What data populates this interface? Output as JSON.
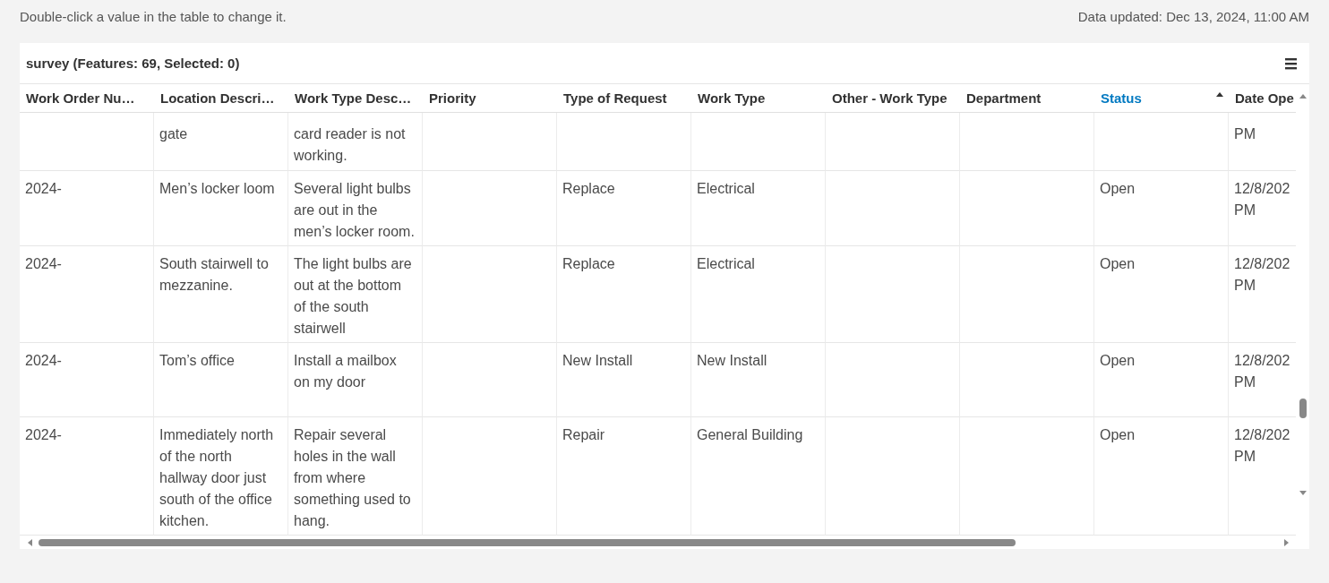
{
  "hint": "Double-click a value in the table to change it.",
  "updated": "Data updated: Dec 13, 2024, 11:00 AM",
  "table": {
    "title": "survey (Features: 69, Selected: 0)",
    "columns": [
      {
        "label": "Work Order Nu…",
        "sorted": false
      },
      {
        "label": "Location Descri…",
        "sorted": false
      },
      {
        "label": "Work Type Desc…",
        "sorted": false
      },
      {
        "label": "Priority",
        "sorted": false
      },
      {
        "label": "Type of Request",
        "sorted": false
      },
      {
        "label": "Work Type",
        "sorted": false
      },
      {
        "label": "Other - Work Type",
        "sorted": false
      },
      {
        "label": "Department",
        "sorted": false
      },
      {
        "label": "Status",
        "sorted": true
      },
      {
        "label": "Date Ope",
        "sorted": false
      }
    ],
    "rows": [
      {
        "kind": "partial",
        "cells": [
          "",
          "gate",
          "card reader is not working.",
          "",
          "",
          "",
          "",
          "",
          "",
          "PM"
        ]
      },
      {
        "kind": "full",
        "cells": [
          "2024-",
          "Men’s locker loom",
          "Several light bulbs are out in the men’s locker room.",
          "",
          "Replace",
          "Electrical",
          "",
          "",
          "Open",
          "12/8/202 PM"
        ]
      },
      {
        "kind": "full",
        "cells": [
          "2024-",
          "South stairwell to mezzanine.",
          "The light bulbs are out at the bottom of the south stairwell",
          "",
          "Replace",
          "Electrical",
          "",
          "",
          "Open",
          "12/8/202 PM"
        ]
      },
      {
        "kind": "full",
        "cells": [
          "2024-",
          "Tom’s office",
          "Install a mailbox on my door",
          "",
          "New Install",
          "New Install",
          "",
          "",
          "Open",
          "12/8/202 PM"
        ]
      },
      {
        "kind": "full",
        "cells": [
          "2024-",
          "Immediately north of the north hallway door just south of the office kitchen.",
          "Repair several holes in the wall from where something used to hang.",
          "",
          "Repair",
          "General Building",
          "",
          "",
          "Open",
          "12/8/202 PM"
        ]
      }
    ]
  }
}
